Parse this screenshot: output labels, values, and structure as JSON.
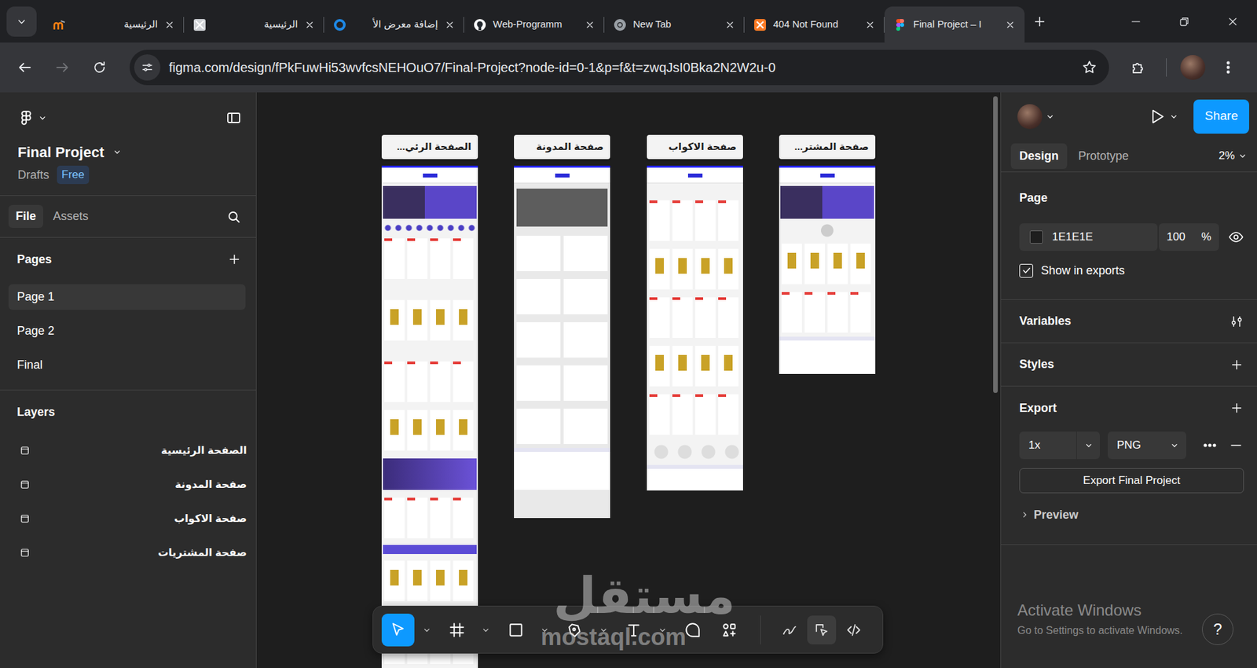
{
  "browser": {
    "tabs": [
      {
        "label": "الرئيسية",
        "kind": "moodle",
        "selected": false
      },
      {
        "label": "الرئيسية",
        "kind": "blank",
        "selected": false
      },
      {
        "label": "إضافة معرض الأ",
        "kind": "ring",
        "selected": false
      },
      {
        "label": "Web-Programm",
        "kind": "github",
        "selected": false
      },
      {
        "label": "New Tab",
        "kind": "chrome",
        "selected": false
      },
      {
        "label": "404 Not Found",
        "kind": "xampp",
        "selected": false
      },
      {
        "label": "Final Project – I",
        "kind": "figma",
        "selected": true
      }
    ],
    "forward": {
      "disabled": true
    },
    "url": "figma.com/design/fPkFuwHi53wvfcsNEHOuO7/Final-Project?node-id=0-1&p=f&t=zwqJsI0Bka2N2W2u-0"
  },
  "figma": {
    "file": {
      "name": "Final Project",
      "location": "Drafts",
      "plan": "Free"
    },
    "left_tabs": [
      {
        "label": "File",
        "selected": true
      },
      {
        "label": "Assets",
        "selected": false
      }
    ],
    "pages_title": "Pages",
    "pages": [
      {
        "label": "Page 1",
        "selected": true
      },
      {
        "label": "Page 2",
        "selected": false
      },
      {
        "label": "Final",
        "selected": false
      }
    ],
    "layers_title": "Layers",
    "layers": [
      {
        "label": "الصفحة الرئيسية"
      },
      {
        "label": "صفحة المدونة"
      },
      {
        "label": "صفحة الاكواب"
      },
      {
        "label": "صفحة المشتريات"
      }
    ],
    "frames": [
      {
        "label": "الصفحة الرئي..."
      },
      {
        "label": "صفحة المدونة"
      },
      {
        "label": "صفحة الاكواب"
      },
      {
        "label": "صفحة المشتر..."
      }
    ],
    "toolbar": {
      "tools": [
        {
          "kind": "move",
          "selected": true,
          "menu": true
        },
        {
          "kind": "frame",
          "selected": false,
          "menu": true
        },
        {
          "kind": "shape",
          "selected": false,
          "menu": true
        },
        {
          "kind": "pen",
          "selected": false,
          "menu": true
        },
        {
          "kind": "text",
          "selected": false,
          "menu": true
        },
        {
          "kind": "comment",
          "selected": false,
          "menu": false
        },
        {
          "kind": "actions",
          "selected": false,
          "menu": false
        }
      ],
      "modes": [
        {
          "kind": "draw",
          "selected": false
        },
        {
          "kind": "design",
          "selected": true
        },
        {
          "kind": "dev",
          "selected": false
        }
      ]
    },
    "right": {
      "share": "Share",
      "tabs": [
        {
          "label": "Design",
          "selected": true
        },
        {
          "label": "Prototype",
          "selected": false
        }
      ],
      "zoom": "2%",
      "page_title": "Page",
      "page_color": "1E1E1E",
      "opacity": "100",
      "percent": "%",
      "show_in_exports": {
        "label": "Show in exports",
        "checked": true
      },
      "variables": "Variables",
      "styles": "Styles",
      "export_title": "Export",
      "scale": "1x",
      "format": "PNG",
      "export_button": "Export Final Project",
      "preview": {
        "label": "Preview",
        "expanded": false
      }
    }
  },
  "watermark": {
    "arabic": "مستقل",
    "latin": "mostaql.com"
  },
  "os_notice": {
    "title": "Activate Windows",
    "detail": "Go to Settings to activate Windows."
  },
  "help": "?"
}
